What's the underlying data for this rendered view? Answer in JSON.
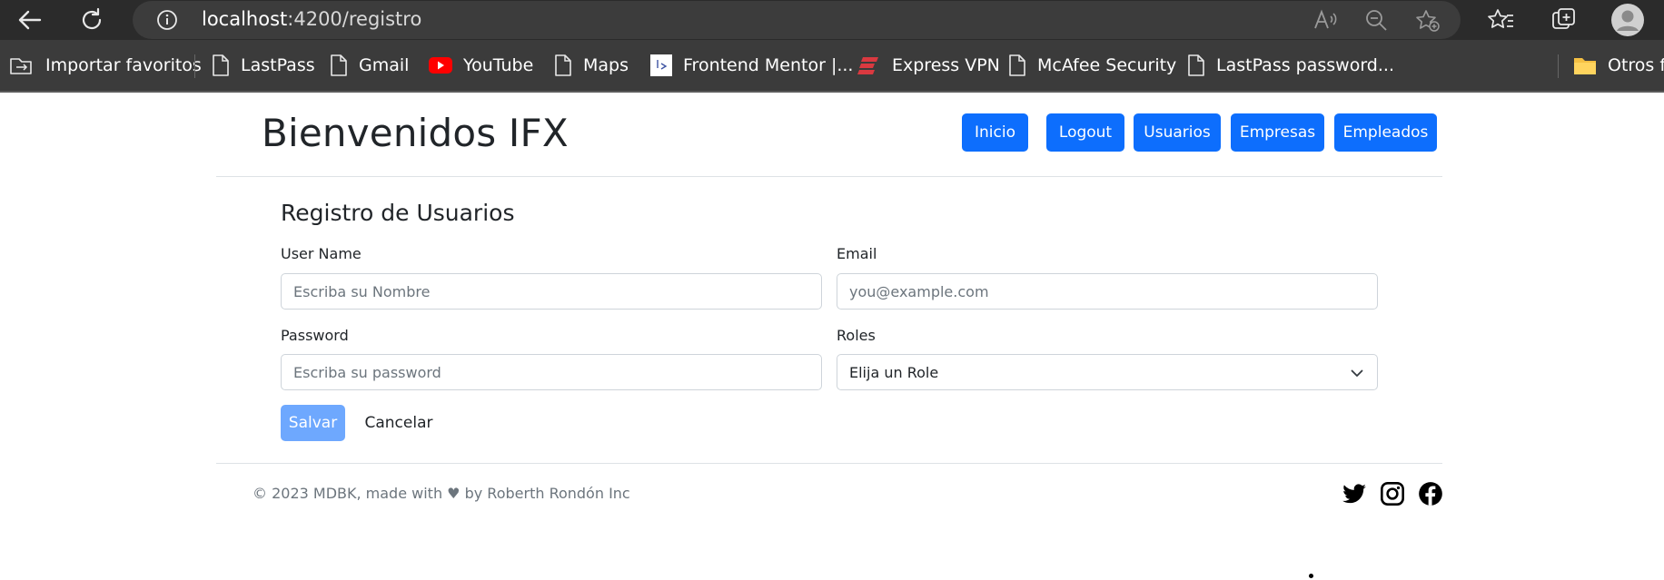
{
  "browser": {
    "url_host": "localhost",
    "url_path": ":4200/registro",
    "bookmarks": [
      {
        "label": "Importar favoritos",
        "icon": "import-icon"
      },
      {
        "label": "LastPass",
        "icon": "page-icon"
      },
      {
        "label": "Gmail",
        "icon": "page-icon"
      },
      {
        "label": "YouTube",
        "icon": "youtube-icon"
      },
      {
        "label": "Maps",
        "icon": "page-icon"
      },
      {
        "label": "Frontend Mentor |...",
        "icon": "frontend-mentor-icon"
      },
      {
        "label": "Express VPN",
        "icon": "expressvpn-icon"
      },
      {
        "label": "McAfee Security",
        "icon": "page-icon"
      },
      {
        "label": "LastPass password...",
        "icon": "page-icon"
      },
      {
        "label": "Otros fa",
        "icon": "folder-icon"
      }
    ]
  },
  "header": {
    "brand": "Bienvenidos IFX",
    "nav": [
      "Inicio",
      "Logout",
      "Usuarios",
      "Empresas",
      "Empleados"
    ],
    "nav_color": "#0d6efd"
  },
  "form": {
    "title": "Registro de Usuarios",
    "username_label": "User Name",
    "username_placeholder": "Escriba su Nombre",
    "email_label": "Email",
    "email_placeholder": "you@example.com",
    "password_label": "Password",
    "password_placeholder": "Escriba su password",
    "roles_label": "Roles",
    "roles_selected": "Elija un Role",
    "save_label": "Salvar",
    "save_color": "#6ea8fe",
    "cancel_label": "Cancelar"
  },
  "footer": {
    "text": "© 2023 MDBK, made with ♥ by Roberth Rondón Inc",
    "social": [
      "twitter-icon",
      "instagram-icon",
      "facebook-icon"
    ]
  }
}
